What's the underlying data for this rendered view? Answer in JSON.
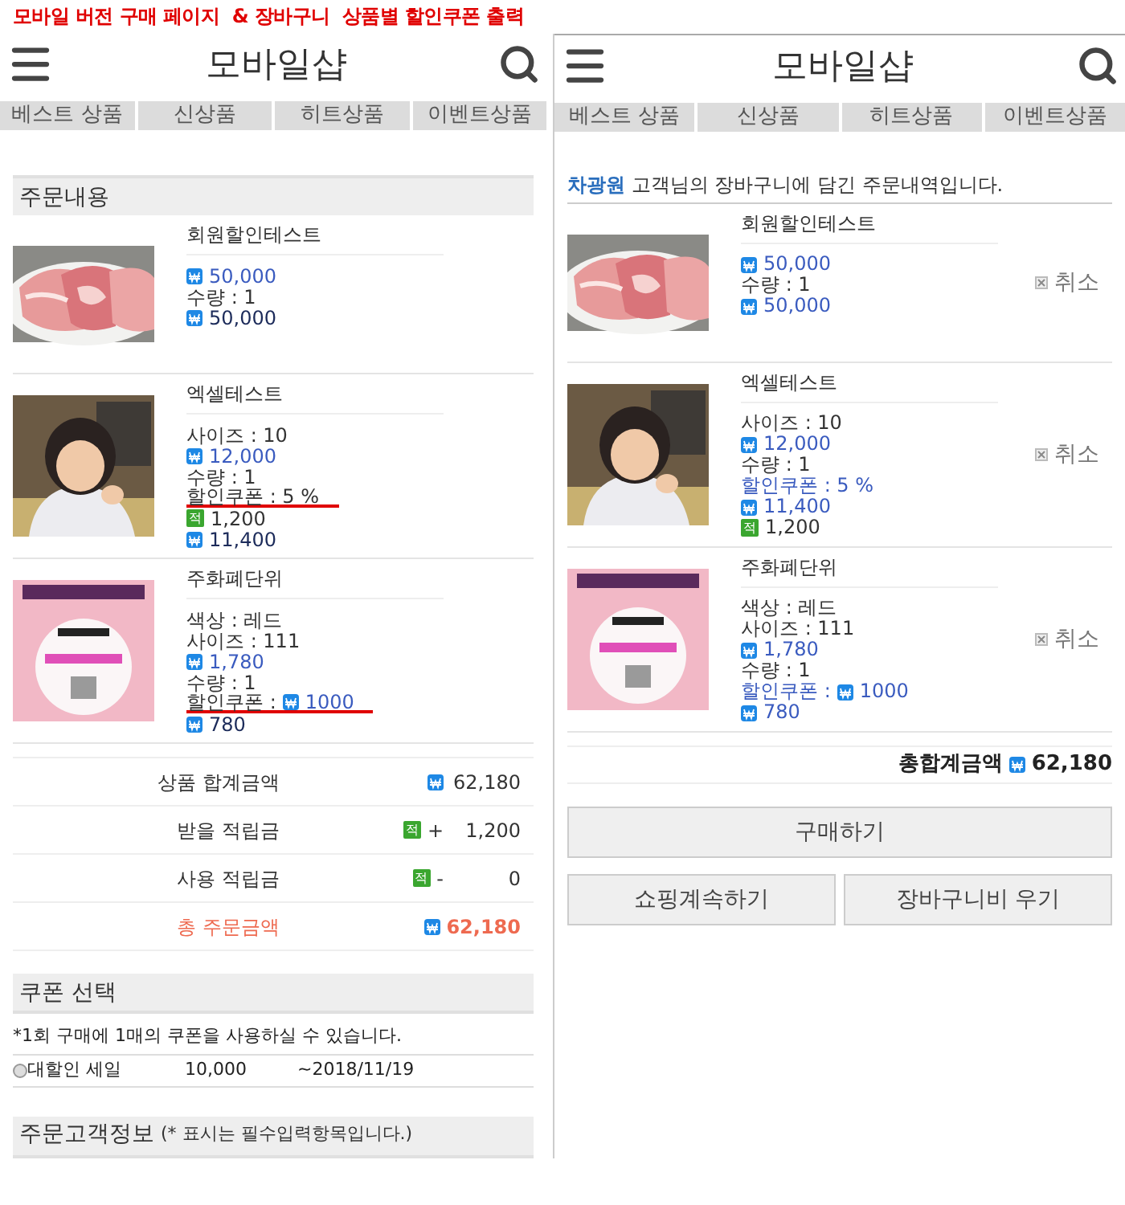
{
  "caption": "모바일 버전 구매 페이지  & 장바구니  상품별 할인쿠폰 출력",
  "order_panel": {
    "header": {
      "title": "모바일샵"
    },
    "tabs": [
      {
        "label": "베스트 상품"
      },
      {
        "label": "신상품"
      },
      {
        "label": "히트상품"
      },
      {
        "label": "이벤트상품"
      }
    ],
    "section_title": "주문내용",
    "items": [
      {
        "name": "회원할인테스트",
        "lines": [
          {
            "kind": "price",
            "text": "50,000",
            "underlined": false
          },
          {
            "kind": "option",
            "text": "수량 : 1",
            "underlined": false
          },
          {
            "kind": "total",
            "text": "50,000",
            "underlined": false
          }
        ]
      },
      {
        "name": "엑셀테스트",
        "lines": [
          {
            "kind": "option",
            "text": "사이즈 : 10",
            "underlined": false
          },
          {
            "kind": "price",
            "text": "12,000",
            "underlined": false
          },
          {
            "kind": "option",
            "text": "수량 : 1",
            "underlined": false
          },
          {
            "kind": "coupon",
            "text": "할인쿠폰 : 5 %",
            "underlined": true
          },
          {
            "kind": "points",
            "badge": "적",
            "text": "1,200",
            "underlined": false
          },
          {
            "kind": "total",
            "text": "11,400",
            "underlined": false
          }
        ]
      },
      {
        "name": "주화폐단위",
        "lines": [
          {
            "kind": "option",
            "text": "색상 : 레드",
            "underlined": false
          },
          {
            "kind": "option",
            "text": "사이즈 : 111",
            "underlined": false
          },
          {
            "kind": "price",
            "text": "1,780",
            "underlined": false
          },
          {
            "kind": "option",
            "text": "수량 : 1",
            "underlined": false
          },
          {
            "kind": "coupon",
            "text": "할인쿠폰 :",
            "amount": "1000",
            "underlined": true
          },
          {
            "kind": "total",
            "text": "780",
            "underlined": false
          }
        ]
      }
    ],
    "summary": [
      {
        "label": "상품 합계금액",
        "kind": "amount",
        "value": "62,180",
        "emphasis": false
      },
      {
        "label": "받을 적립금",
        "kind": "points",
        "badge": "적",
        "sign": "+",
        "value": "1,200",
        "emphasis": false
      },
      {
        "label": "사용 적립금",
        "kind": "points",
        "badge": "적",
        "sign": "-",
        "value": "0",
        "emphasis": false
      },
      {
        "label": "총 주문금액",
        "kind": "amount",
        "value": "62,180",
        "emphasis": true
      }
    ],
    "coupon_section": {
      "title": "쿠폰 선택",
      "note": "*1회 구매에 1매의 쿠폰을 사용하실 수 있습니다.",
      "coupons": [
        {
          "name": "대할인 세일",
          "amount": "10,000",
          "expiry": "~2018/11/19",
          "selected": false
        }
      ]
    },
    "customer_section": {
      "title": "주문고객정보",
      "note": "(* 표시는 필수입력항목입니다.)"
    }
  },
  "cart_panel": {
    "header": {
      "title": "모바일샵"
    },
    "tabs": [
      {
        "label": "베스트 상품"
      },
      {
        "label": "신상품"
      },
      {
        "label": "히트상품"
      },
      {
        "label": "이벤트상품"
      }
    ],
    "greeting": {
      "name": "차광원",
      "text": "고객님의 장바구니에 담긴 주문내역입니다."
    },
    "items": [
      {
        "name": "회원할인테스트",
        "cancel": "취소",
        "lines": [
          {
            "kind": "price",
            "text": "50,000"
          },
          {
            "kind": "option",
            "text": "수량 : 1"
          },
          {
            "kind": "total",
            "text": "50,000"
          }
        ]
      },
      {
        "name": "엑셀테스트",
        "cancel": "취소",
        "lines": [
          {
            "kind": "option",
            "text": "사이즈 : 10"
          },
          {
            "kind": "price",
            "text": "12,000"
          },
          {
            "kind": "option",
            "text": "수량 : 1"
          },
          {
            "kind": "coupon",
            "text": "할인쿠폰 : 5 %"
          },
          {
            "kind": "total",
            "text": "11,400"
          },
          {
            "kind": "points",
            "badge": "적",
            "text": "1,200"
          }
        ]
      },
      {
        "name": "주화폐단위",
        "cancel": "취소",
        "lines": [
          {
            "kind": "option",
            "text": "색상 : 레드"
          },
          {
            "kind": "option",
            "text": "사이즈 : 111"
          },
          {
            "kind": "price",
            "text": "1,780"
          },
          {
            "kind": "option",
            "text": "수량 : 1"
          },
          {
            "kind": "coupon",
            "text": "할인쿠폰 :",
            "amount": "1000"
          },
          {
            "kind": "total",
            "text": "780"
          }
        ]
      }
    ],
    "total": {
      "label": "총합계금액",
      "value": "62,180"
    },
    "buttons": [
      {
        "label": "구매하기"
      },
      {
        "label": "쇼핑계속하기"
      },
      {
        "label": "장바구니비 우기"
      }
    ]
  }
}
